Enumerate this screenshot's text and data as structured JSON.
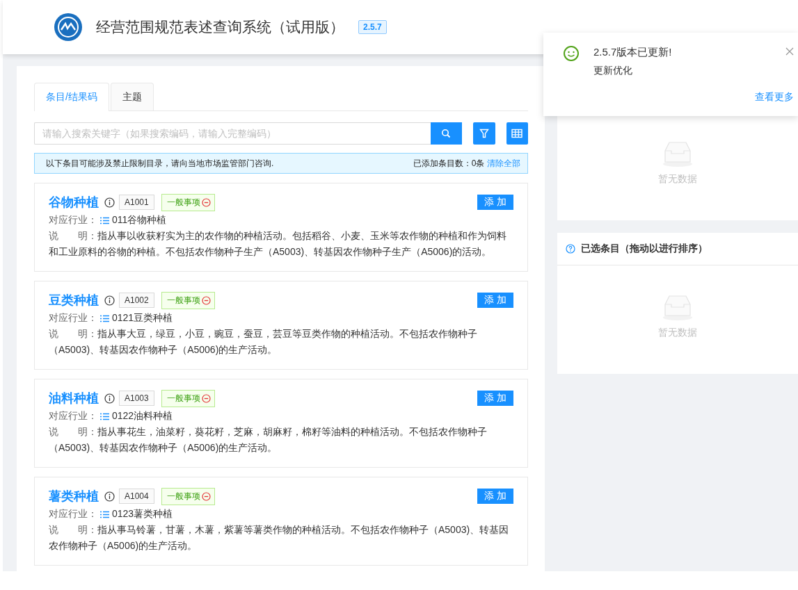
{
  "header": {
    "title": "经营范围规范表述查询系统（试用版）",
    "version": "2.5.7"
  },
  "tabs": [
    {
      "label": "条目/结果码",
      "selected": true
    },
    {
      "label": "主题",
      "selected": false
    }
  ],
  "search": {
    "placeholder": "请输入搜索关键字（如果搜索编码，请输入完整编码）"
  },
  "notice": {
    "text": "以下条目可能涉及禁止限制目录，请向当地市场监管部门咨询.",
    "count_label": "已添加条目数：0条",
    "clear_link": "清除全部"
  },
  "entries": [
    {
      "name": "谷物种植",
      "code": "A1001",
      "tag": "一般事项",
      "industry_label": "对应行业：",
      "industry": "011谷物种植",
      "desc_label": "说　　明：",
      "desc": "指从事以收获籽实为主的农作物的种植活动。包括稻谷、小麦、玉米等农作物的种植和作为饲料和工业原料的谷物的种植。不包括农作物种子生产（A5003)、转基因农作物种子生产（A5006)的活动。",
      "add": "添 加"
    },
    {
      "name": "豆类种植",
      "code": "A1002",
      "tag": "一般事项",
      "industry_label": "对应行业：",
      "industry": "0121豆类种植",
      "desc_label": "说　　明：",
      "desc": "指从事大豆，绿豆，小豆，豌豆，蚕豆，芸豆等豆类作物的种植活动。不包括农作物种子（A5003)、转基因农作物种子（A5006)的生产活动。",
      "add": "添 加"
    },
    {
      "name": "油料种植",
      "code": "A1003",
      "tag": "一般事项",
      "industry_label": "对应行业：",
      "industry": "0122油料种植",
      "desc_label": "说　　明：",
      "desc": "指从事花生，油菜籽，葵花籽，芝麻，胡麻籽，棉籽等油料的种植活动。不包括农作物种子（A5003)、转基因农作物种子（A5006)的生产活动。",
      "add": "添 加"
    },
    {
      "name": "薯类种植",
      "code": "A1004",
      "tag": "一般事项",
      "industry_label": "对应行业：",
      "industry": "0123薯类种植",
      "desc_label": "说　　明：",
      "desc": "指从事马铃薯，甘薯，木薯，紫薯等薯类作物的种植活动。不包括农作物种子（A5003)、转基因农作物种子（A5006)的生产活动。",
      "add": "添 加"
    }
  ],
  "panels": [
    {
      "empty_text": "暂无数据"
    },
    {
      "title": "已选条目（拖动以进行排序）",
      "empty_text": "暂无数据"
    }
  ],
  "notification": {
    "title": "2.5.7版本已更新!",
    "body": "更新优化",
    "link": "查看更多"
  }
}
